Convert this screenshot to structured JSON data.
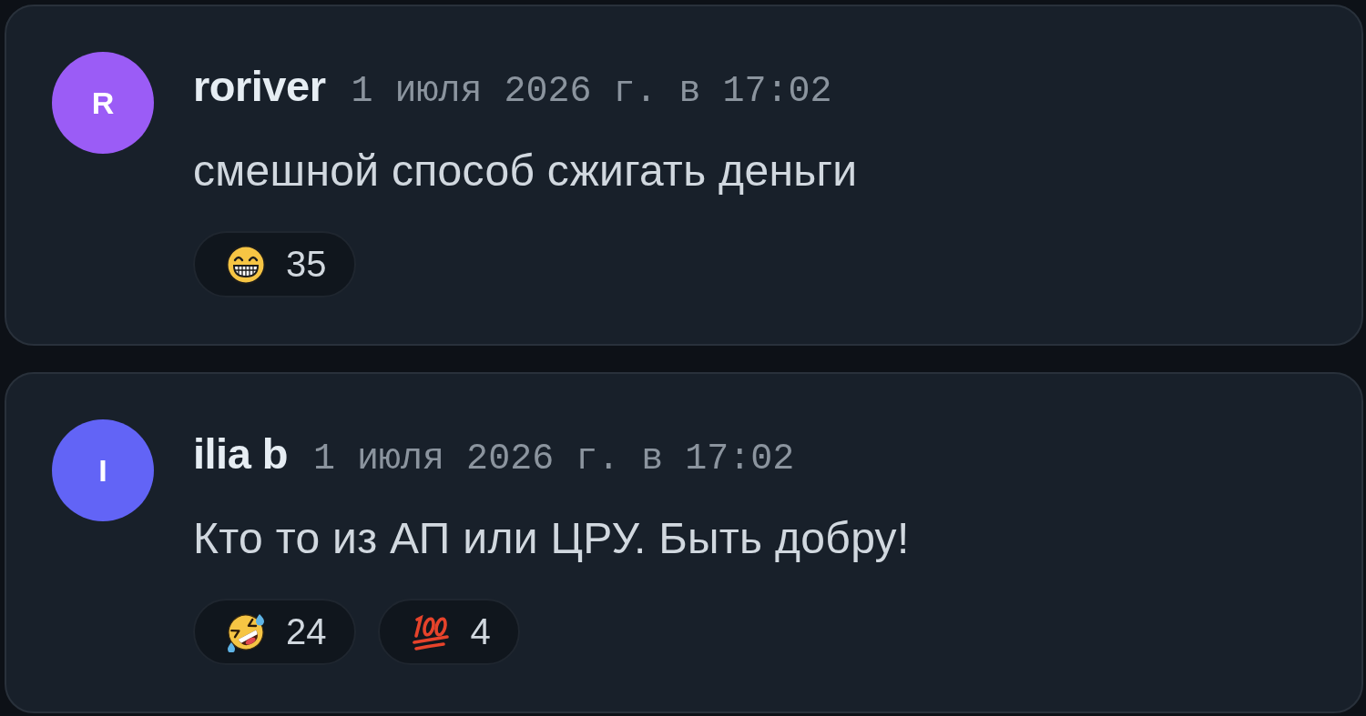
{
  "comments": [
    {
      "author": "roriver",
      "avatar": {
        "letter": "R",
        "color": "#9b5cf6"
      },
      "timestamp": "1 июля 2026 г. в 17:02",
      "text": "смешной способ сжигать деньги",
      "reactions": [
        {
          "kind": "grin",
          "count": "35"
        }
      ]
    },
    {
      "author": "ilia b",
      "avatar": {
        "letter": "I",
        "color": "#6264f6"
      },
      "timestamp": "1 июля 2026 г. в 17:02",
      "text": "Кто то из АП или ЦРУ. Быть добру!",
      "reactions": [
        {
          "kind": "rofl",
          "count": "24"
        },
        {
          "kind": "hundred",
          "count": "4"
        }
      ]
    }
  ]
}
